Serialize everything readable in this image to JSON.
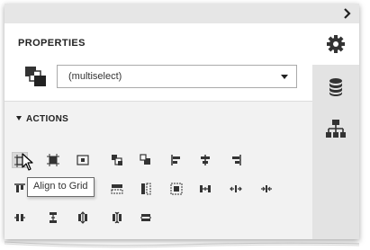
{
  "panel": {
    "title": "PROPERTIES",
    "collapse_icon": "chevron-right-icon"
  },
  "selector": {
    "value": "(multiselect)",
    "icon": "multiselect-objects-icon"
  },
  "section": {
    "label": "ACTIONS",
    "expanded": true
  },
  "tooltip": {
    "text": "Align to Grid"
  },
  "sidebar": {
    "tabs": [
      {
        "name": "properties-tab",
        "icon": "gear-icon",
        "active": true
      },
      {
        "name": "data-source-tab",
        "icon": "database-icon",
        "active": false
      },
      {
        "name": "report-explorer-tab",
        "icon": "hierarchy-icon",
        "active": false
      }
    ]
  },
  "actions": [
    "align-to-grid-icon",
    "size-to-grid-icon",
    "center-horizontally-icon",
    "bring-to-front-icon",
    "send-to-back-icon",
    "align-lefts-icon",
    "align-centers-icon",
    "align-rights-icon",
    "align-tops-icon",
    "align-middles-icon",
    "align-bottoms-icon",
    "same-size-icon",
    "same-width-icon",
    "same-height-icon",
    "horizontal-spacing-equal-icon",
    "horizontal-spacing-increase-icon",
    "horizontal-spacing-decrease-icon",
    "horizontal-spacing-remove-icon",
    "vertical-spacing-equal-icon",
    "vertical-spacing-increase-icon",
    "vertical-spacing-decrease-icon",
    "vertical-spacing-remove-icon"
  ],
  "colors": {
    "panel_bg": "#ffffff",
    "section_bg": "#f2f2f2",
    "sidebar_bg": "#e3e3e3",
    "icon": "#333333"
  }
}
